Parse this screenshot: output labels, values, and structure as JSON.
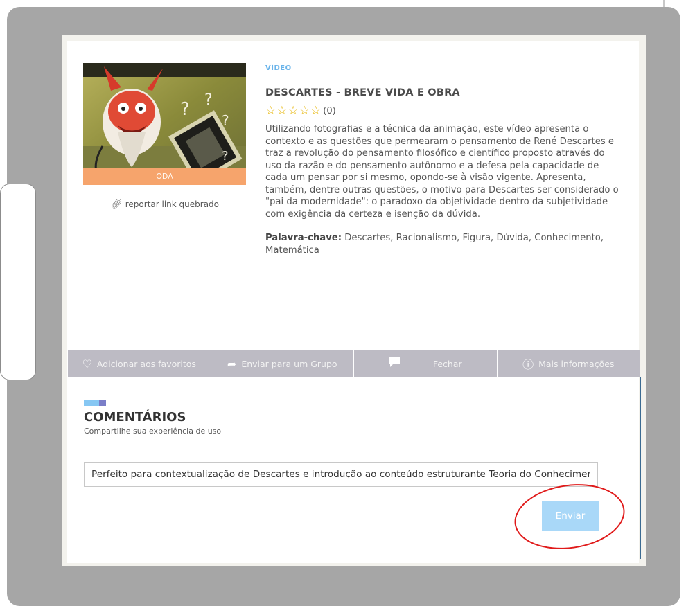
{
  "resource": {
    "thumbnail_label": "ODA",
    "report_link": "reportar link quebrado",
    "type": "VÍDEO",
    "title": "DESCARTES - BREVE VIDA E OBRA",
    "rating": {
      "stars_total": 5,
      "stars_filled": 0,
      "count": "(0)"
    },
    "description": "Utilizando fotografias e a técnica da animação, este vídeo apresenta o contexto e as questões que permearam o pensamento de René Descartes e traz a revolução do pensamento filosófico e científico proposto através do uso da razão e do pensamento autônomo e a defesa pela capacidade de cada um pensar por si mesmo, opondo-se à visão vigente. Apresenta, também, dentre outras questões, o motivo para Descartes ser considerado o \"pai da modernidade\": o paradoxo da objetividade dentro da subjetividade com exigência da certeza e isenção da dúvida.",
    "keywords_label": "Palavra-chave:",
    "keywords": "Descartes, Racionalismo, Figura, Dúvida, Conhecimento, Matemática"
  },
  "actions": {
    "favorite": "Adicionar aos favoritos",
    "send_group": "Enviar para um Grupo",
    "close": "Fechar",
    "more_info": "Mais informações"
  },
  "comments": {
    "title": "COMENTÁRIOS",
    "subtitle": "Compartilhe sua experiência de uso",
    "input_value": "Perfeito para contextualização de Descartes e introdução ao conteúdo estruturante Teoria do Conhecimento",
    "send_label": "Enviar"
  },
  "colors": {
    "accent_blue": "#86c7f3",
    "accent_purple": "#7a7ec8",
    "type_label": "#6ab4ea",
    "action_bar": "#bdbbc4",
    "send_button": "#a9d8f8",
    "thumbnail_label_bg": "#f6a46c",
    "highlight": "#e01a1a",
    "star": "#e6b400"
  },
  "icons": {
    "favorite": "heart-outline-icon",
    "send_group": "share-arrow-icon",
    "close": "speech-bubble-icon",
    "more_info": "info-circle-icon",
    "report": "link-icon",
    "star": "star-outline-icon"
  }
}
